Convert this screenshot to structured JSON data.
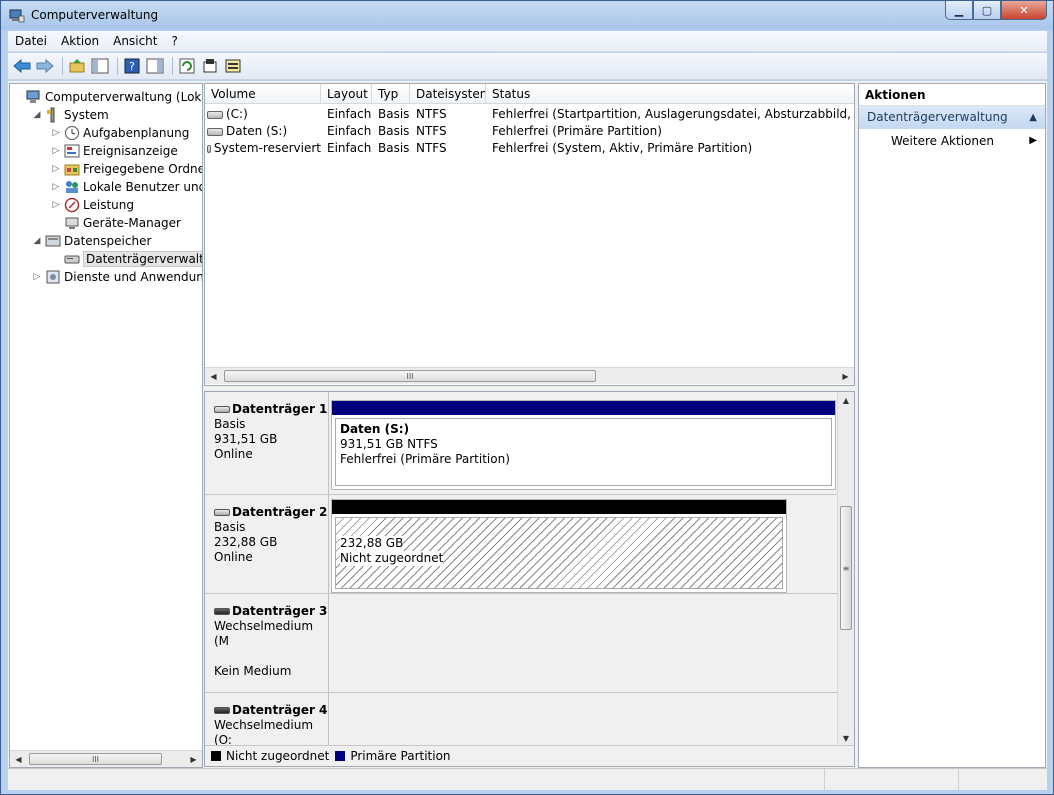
{
  "window": {
    "title": "Computerverwaltung"
  },
  "menu": [
    "Datei",
    "Aktion",
    "Ansicht",
    "?"
  ],
  "tree": [
    {
      "label": "Computerverwaltung (Lokal)",
      "level": 0,
      "expander": "",
      "icon": "computer-icon"
    },
    {
      "label": "System",
      "level": 1,
      "expander": "◢",
      "icon": "tools-icon"
    },
    {
      "label": "Aufgabenplanung",
      "level": 2,
      "expander": "▷",
      "icon": "clock-icon"
    },
    {
      "label": "Ereignisanzeige",
      "level": 2,
      "expander": "▷",
      "icon": "event-viewer-icon"
    },
    {
      "label": "Freigegebene Ordner",
      "level": 2,
      "expander": "▷",
      "icon": "shared-folder-icon"
    },
    {
      "label": "Lokale Benutzer und Gr",
      "level": 2,
      "expander": "▷",
      "icon": "users-icon"
    },
    {
      "label": "Leistung",
      "level": 2,
      "expander": "▷",
      "icon": "performance-icon"
    },
    {
      "label": "Geräte-Manager",
      "level": 2,
      "expander": "",
      "icon": "device-manager-icon"
    },
    {
      "label": "Datenspeicher",
      "level": 1,
      "expander": "◢",
      "icon": "storage-icon"
    },
    {
      "label": "Datenträgerverwaltung",
      "level": 2,
      "expander": "",
      "icon": "disk-management-icon",
      "selected": true
    },
    {
      "label": "Dienste und Anwendungen",
      "level": 1,
      "expander": "▷",
      "icon": "services-icon"
    }
  ],
  "volumes": {
    "columns": [
      "Volume",
      "Layout",
      "Typ",
      "Dateisystem",
      "Status"
    ],
    "rows": [
      [
        "(C:)",
        "Einfach",
        "Basis",
        "NTFS",
        "Fehlerfrei (Startpartition, Auslagerungsdatei, Absturzabbild, Primäre P"
      ],
      [
        "Daten (S:)",
        "Einfach",
        "Basis",
        "NTFS",
        "Fehlerfrei (Primäre Partition)"
      ],
      [
        "System-reserviert",
        "Einfach",
        "Basis",
        "NTFS",
        "Fehlerfrei (System, Aktiv, Primäre Partition)"
      ]
    ]
  },
  "disks": [
    {
      "name": "Datenträger 1",
      "type": "Basis",
      "size": "931,51 GB",
      "state": "Online",
      "partition": {
        "title": "Daten  (S:)",
        "size": "931,51 GB NTFS",
        "status": "Fehlerfrei (Primäre Partition)",
        "bar_color": "#00007f"
      }
    },
    {
      "name": "Datenträger 2",
      "type": "Basis",
      "size": "232,88 GB",
      "state": "Online",
      "partition": {
        "size": "232,88 GB",
        "status": "Nicht zugeordnet",
        "bar_color": "#000000"
      }
    },
    {
      "name": "Datenträger 3",
      "type": "Wechselmedium (M",
      "state": "Kein Medium"
    },
    {
      "name": "Datenträger 4",
      "type": "Wechselmedium (O:"
    }
  ],
  "legend": [
    {
      "label": "Nicht zugeordnet",
      "color": "#000000"
    },
    {
      "label": "Primäre Partition",
      "color": "#00007f"
    }
  ],
  "actions": {
    "header": "Aktionen",
    "section": "Datenträgerverwaltung",
    "item": "Weitere Aktionen"
  },
  "scroll": {
    "thumb_grip": "III",
    "vgrip": "≡"
  }
}
